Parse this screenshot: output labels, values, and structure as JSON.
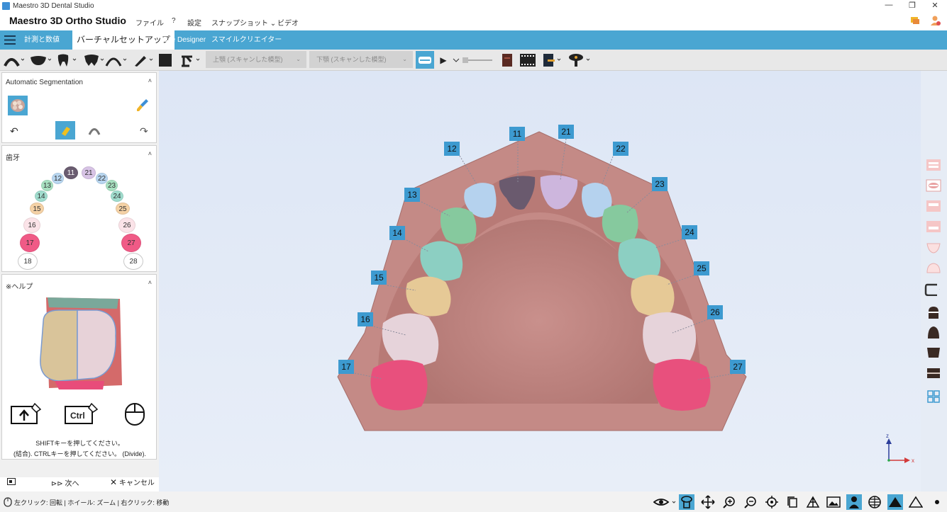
{
  "window": {
    "title": "Maestro 3D Dental Studio",
    "minimize_glyph": "—",
    "restore_glyph": "❐",
    "close_glyph": "✕"
  },
  "menubar": {
    "brand": "Maestro 3D Ortho Studio",
    "items": [
      {
        "label": "ファイル"
      },
      {
        "label": "?"
      },
      {
        "label": "設定"
      },
      {
        "label": "スナップショット ⌄"
      },
      {
        "label": "ビデオ"
      }
    ]
  },
  "tabs": {
    "menu_icon": "hamburger-icon",
    "items": [
      {
        "label": "計測と数値",
        "active": false
      },
      {
        "label": "バーチャルセットアップ",
        "active": true
      },
      {
        "label": "Bite Designer",
        "active": false
      },
      {
        "label": "スマイルクリエイター",
        "active": false
      }
    ]
  },
  "toolbar": {
    "upper_select": "上顎 (スキャンした模型)",
    "lower_select": "下顎 (スキャンした模型)",
    "play_glyph": "▶",
    "accent": "#4aa6d2"
  },
  "segmentation_panel": {
    "title": "Automatic Segmentation",
    "collapse": "˄",
    "undo_glyph": "↶",
    "redo_glyph": "↷"
  },
  "teeth_panel": {
    "title": "歯牙",
    "collapse": "˄",
    "teeth": [
      {
        "num": "11",
        "color": "#6a5c70",
        "text": "#fff"
      },
      {
        "num": "21",
        "color": "#d8c4e6",
        "text": "#333"
      },
      {
        "num": "12",
        "color": "#b8d6f0",
        "text": "#333"
      },
      {
        "num": "22",
        "color": "#b8d6f0",
        "text": "#333"
      },
      {
        "num": "13",
        "color": "#a8e0c0",
        "text": "#333"
      },
      {
        "num": "23",
        "color": "#a8e0c0",
        "text": "#333"
      },
      {
        "num": "14",
        "color": "#a0dccd",
        "text": "#333"
      },
      {
        "num": "24",
        "color": "#a0dccd",
        "text": "#333"
      },
      {
        "num": "15",
        "color": "#f5d2a6",
        "text": "#333"
      },
      {
        "num": "25",
        "color": "#f5d2a6",
        "text": "#333"
      },
      {
        "num": "16",
        "color": "#fbe3e8",
        "text": "#333"
      },
      {
        "num": "26",
        "color": "#fbe3e8",
        "text": "#333"
      },
      {
        "num": "17",
        "color": "#f05a86",
        "text": "#333"
      },
      {
        "num": "27",
        "color": "#f05a86",
        "text": "#333"
      },
      {
        "num": "18",
        "color": "#ffffff",
        "text": "#333"
      },
      {
        "num": "28",
        "color": "#ffffff",
        "text": "#333"
      }
    ]
  },
  "help_panel": {
    "title": "※ヘルプ",
    "collapse": "˄",
    "shift_key": "⇧",
    "ctrl_key": "Ctrl",
    "line1": "SHIFTキーを押してください。",
    "line2": "(結合). CTRLキーを押してください。 (Divide)."
  },
  "footer": {
    "next_label": "次へ",
    "next_glyph": "⊳⊳",
    "cancel_label": "キャンセル",
    "cancel_glyph": "✕"
  },
  "viewport": {
    "tooth_labels": [
      "11",
      "21",
      "12",
      "22",
      "13",
      "23",
      "14",
      "24",
      "15",
      "25",
      "16",
      "26",
      "17",
      "27"
    ],
    "axis_z": "z",
    "axis_x": "x"
  },
  "statusbar": {
    "hint": "左クリック: 回転 | ホイール: ズーム | 右クリック: 移動"
  }
}
